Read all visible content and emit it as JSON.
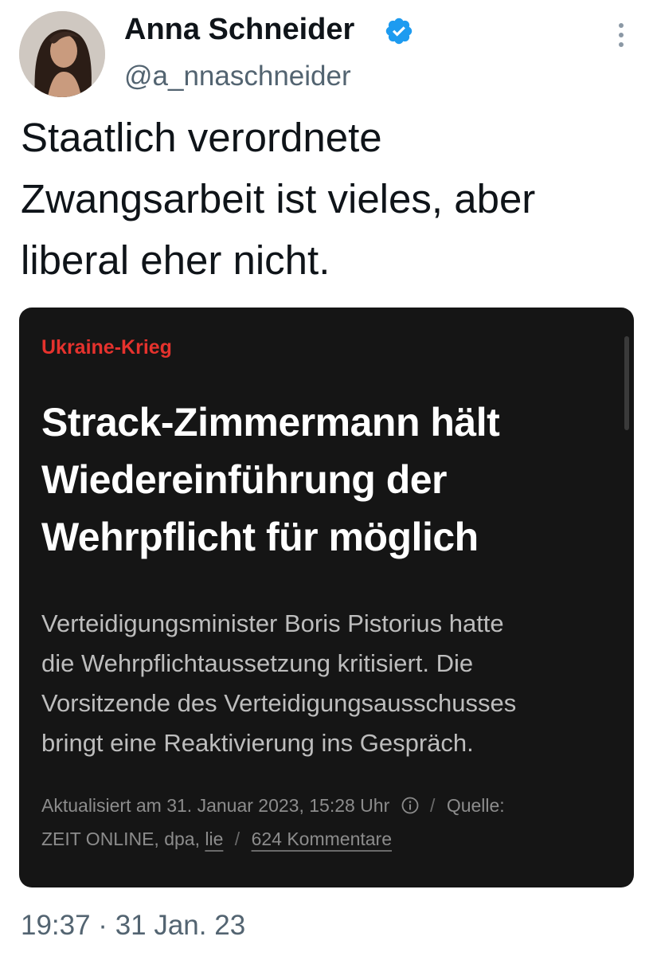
{
  "author": {
    "display_name": "Anna Schneider",
    "handle": "@a_nnaschneider",
    "avatar_icon": "profile-photo",
    "verified_icon": "verified-badge-icon",
    "verified_color": "#1d9bf0"
  },
  "menu_icon": "more-vertical-icon",
  "tweet": {
    "text_lines": [
      "Staatlich verordnete",
      "Zwangsarbeit ist vieles, aber",
      "liberal eher nicht."
    ],
    "timestamp": "19:37 · 31 Jan. 23"
  },
  "card": {
    "background": "#151515",
    "kicker": "Ukraine-Krieg",
    "kicker_color": "#e5322d",
    "headline_lines": [
      "Strack-Zimmermann hält",
      "Wiedereinführung der",
      "Wehrpflicht für möglich"
    ],
    "summary_lines": [
      "Verteidigungsminister Boris Pistorius hatte",
      "die Wehrpflichtaussetzung kritisiert. Die",
      "Vorsitzende des Verteidigungsausschusses",
      "bringt eine Reaktivierung ins Gespräch."
    ],
    "meta": {
      "updated": "Aktualisiert am 31. Januar 2023, 15:28 Uhr",
      "info_icon": "info-icon",
      "separator": "/",
      "source_label": "Quelle:",
      "source": "ZEIT ONLINE, dpa,",
      "source_link": "lie",
      "comments": "624 Kommentare"
    }
  }
}
